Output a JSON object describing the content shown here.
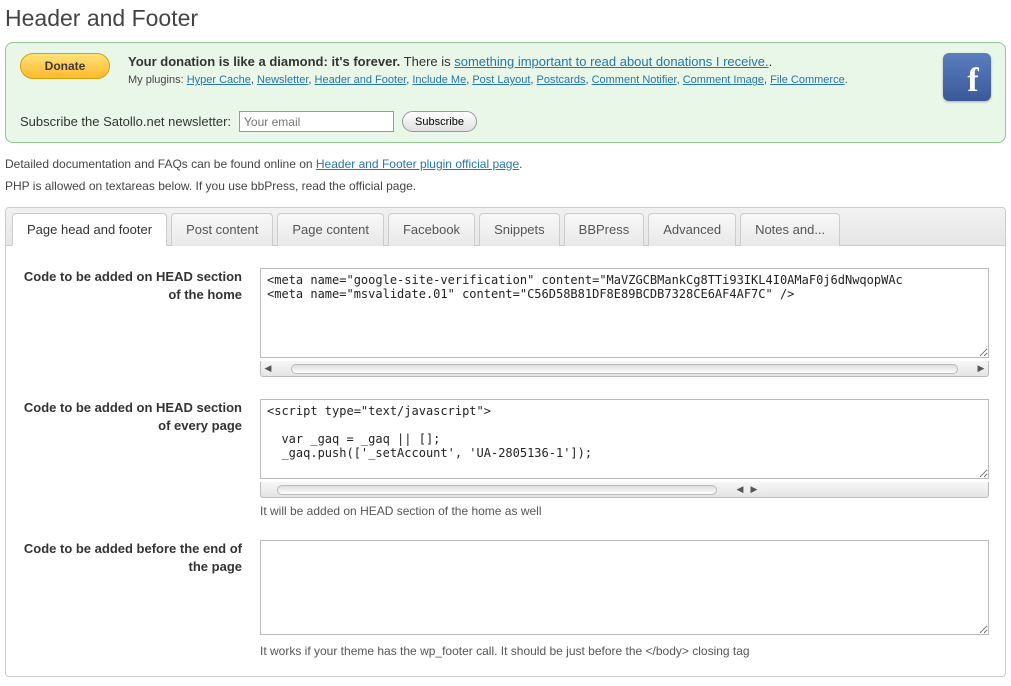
{
  "page_title": "Header and Footer",
  "donation": {
    "lead_bold": "Your donation is like a diamond: it's forever.",
    "lead_rest": " There is ",
    "lead_link": "something important to read about donations I receive.",
    "lead_end": ".",
    "plugins_label": "My plugins: ",
    "plugins": [
      "Hyper Cache",
      "Newsletter",
      "Header and Footer",
      "Include Me",
      "Post Layout",
      "Postcards",
      "Comment Notifier",
      "Comment Image",
      "File Commerce"
    ],
    "donate_btn": "Donate"
  },
  "subscribe": {
    "label": "Subscribe the Satollo.net newsletter:",
    "placeholder": "Your email",
    "button": "Subscribe"
  },
  "intro": {
    "line1a": "Detailed documentation and FAQs can be found online on ",
    "line1link": "Header and Footer plugin official page",
    "line1b": ".",
    "line2": "PHP is allowed on textareas below. If you use bbPress, read the official page."
  },
  "tabs": [
    "Page head and footer",
    "Post content",
    "Page content",
    "Facebook",
    "Snippets",
    "BBPress",
    "Advanced",
    "Notes and..."
  ],
  "fields": {
    "head_home": {
      "label": "Code to be added on HEAD section of the home",
      "value": "<meta name=\"google-site-verification\" content=\"MaVZGCBMankCg8TTi93IKL4I0AMaF0j6dNwqopWAc\n<meta name=\"msvalidate.01\" content=\"C56D58B81DF8E89BCDB7328CE6AF4AF7C\" />"
    },
    "head_every": {
      "label": "Code to be added on HEAD section of every page",
      "value": "<script type=\"text/javascript\">\n\n  var _gaq = _gaq || [];\n  _gaq.push(['_setAccount', 'UA-2805136-1']);",
      "help": "It will be added on HEAD section of the home as well"
    },
    "before_end": {
      "label": "Code to be added before the end of the page",
      "value": "",
      "help": "It works if your theme has the wp_footer call. It should be just before the </body> closing tag"
    }
  }
}
